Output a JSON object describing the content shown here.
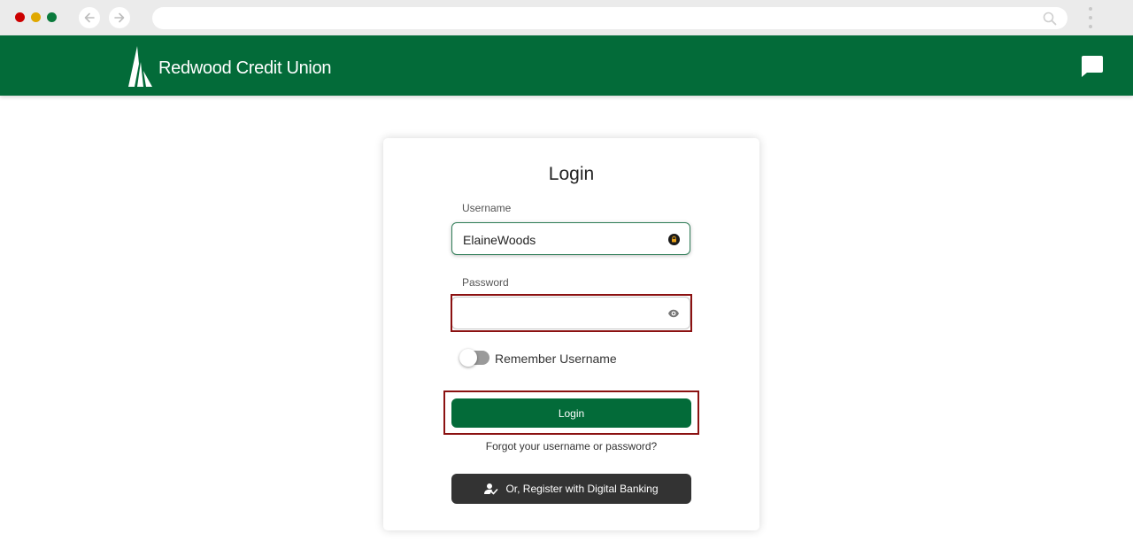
{
  "browser": {
    "traffic_lights": [
      "#cc0000",
      "#e0a800",
      "#0a7a3c"
    ],
    "address": ""
  },
  "header": {
    "brand": "Redwood Credit Union",
    "brand_color": "#036b39"
  },
  "login": {
    "title": "Login",
    "username_label": "Username",
    "username_value": "ElaineWoods",
    "password_label": "Password",
    "password_value": "",
    "remember_label": "Remember Username",
    "remember_on": false,
    "login_button": "Login",
    "forgot_link": "Forgot your username or password?",
    "register_button": "Or, Register with Digital Banking"
  },
  "highlight_color": "#8b1111"
}
